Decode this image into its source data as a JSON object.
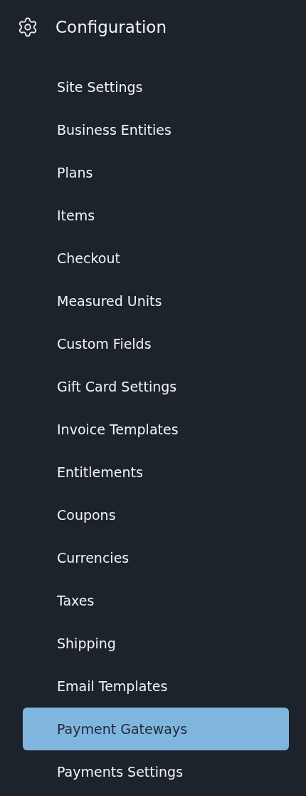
{
  "section": {
    "title": "Configuration"
  },
  "items": [
    {
      "label": "Site Settings",
      "selected": false
    },
    {
      "label": "Business Entities",
      "selected": false
    },
    {
      "label": "Plans",
      "selected": false
    },
    {
      "label": "Items",
      "selected": false
    },
    {
      "label": "Checkout",
      "selected": false
    },
    {
      "label": "Measured Units",
      "selected": false
    },
    {
      "label": "Custom Fields",
      "selected": false
    },
    {
      "label": "Gift Card Settings",
      "selected": false
    },
    {
      "label": "Invoice Templates",
      "selected": false
    },
    {
      "label": "Entitlements",
      "selected": false
    },
    {
      "label": "Coupons",
      "selected": false
    },
    {
      "label": "Currencies",
      "selected": false
    },
    {
      "label": "Taxes",
      "selected": false
    },
    {
      "label": "Shipping",
      "selected": false
    },
    {
      "label": "Email Templates",
      "selected": false
    },
    {
      "label": "Payment Gateways",
      "selected": true
    },
    {
      "label": "Payments Settings",
      "selected": false
    }
  ]
}
